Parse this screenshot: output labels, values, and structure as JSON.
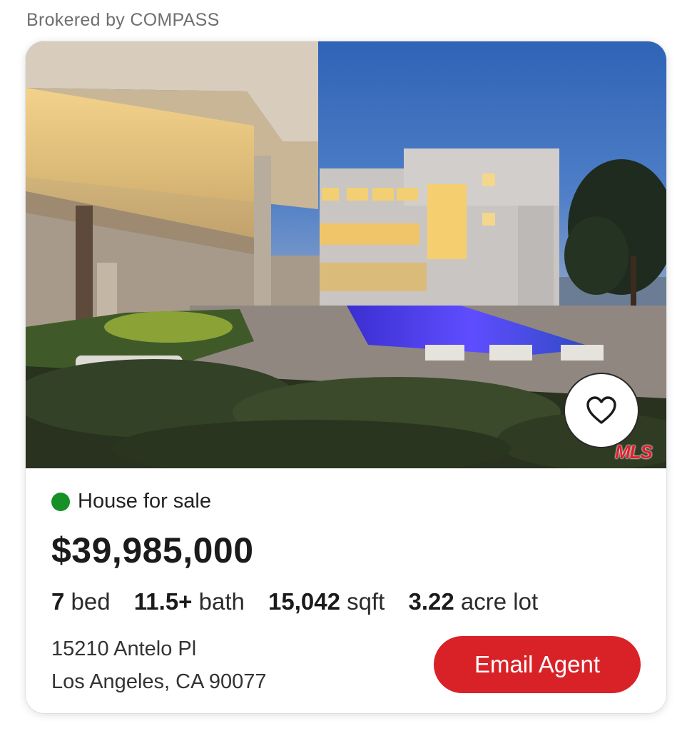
{
  "broker_text": "Brokered by COMPASS",
  "listing": {
    "status": "House for sale",
    "status_color": "#179028",
    "price": "$39,985,000",
    "specs": [
      {
        "value": "7",
        "unit": "bed"
      },
      {
        "value": "11.5+",
        "unit": "bath"
      },
      {
        "value": "15,042",
        "unit": "sqft"
      },
      {
        "value": "3.22",
        "unit": "acre lot"
      }
    ],
    "address_line1": "15210 Antelo Pl",
    "address_line2": "Los Angeles, CA 90077",
    "email_label": "Email Agent",
    "accent_color": "#d92228",
    "mls_logo_text": "MLS",
    "favorite_icon": "heart-outline-icon"
  }
}
